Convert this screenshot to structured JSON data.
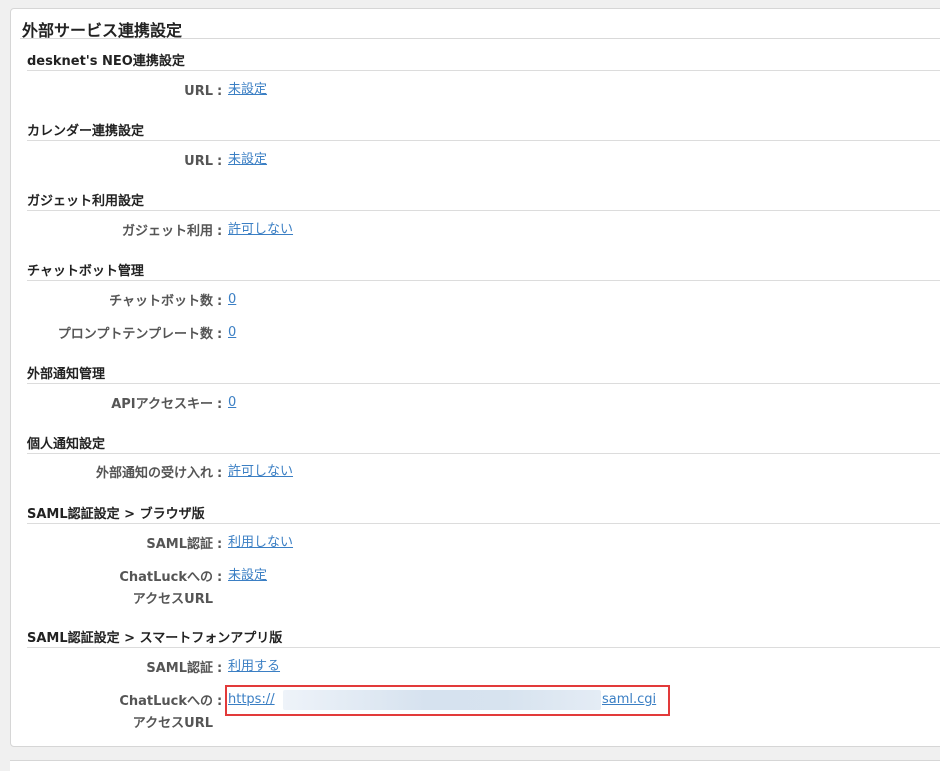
{
  "page": {
    "title": "外部サービス連携設定"
  },
  "sections": {
    "neo": {
      "heading": "desknet's NEO連携設定",
      "url_label": "URL",
      "url_value": "未設定"
    },
    "calendar": {
      "heading": "カレンダー連携設定",
      "url_label": "URL",
      "url_value": "未設定"
    },
    "gadget": {
      "heading": "ガジェット利用設定",
      "use_label": "ガジェット利用",
      "use_value": "許可しない"
    },
    "chatbot": {
      "heading": "チャットボット管理",
      "count_label": "チャットボット数",
      "count_value": "0",
      "template_label": "プロンプトテンプレート数",
      "template_value": "0"
    },
    "external_notify": {
      "heading": "外部通知管理",
      "apikey_label": "APIアクセスキー",
      "apikey_value": "0"
    },
    "personal_notify": {
      "heading": "個人通知設定",
      "accept_label": "外部通知の受け入れ",
      "accept_value": "許可しない"
    },
    "saml_browser": {
      "heading": "SAML認証設定 > ブラウザ版",
      "auth_label": "SAML認証",
      "auth_value": "利用しない",
      "url_label_line1": "ChatLuckへの",
      "url_label_line2": "アクセスURL",
      "url_value": "未設定"
    },
    "saml_smartphone": {
      "heading": "SAML認証設定 > スマートフォンアプリ版",
      "auth_label": "SAML認証",
      "auth_value": "利用する",
      "url_label_line1": "ChatLuckへの",
      "url_label_line2": "アクセスURL",
      "url_prefix": "https://",
      "url_suffix": "saml.cgi"
    }
  },
  "separator": ":",
  "colors": {
    "link": "#3b7fc4",
    "highlight_box": "#e23a3a",
    "label": "#555555",
    "heading": "#222222"
  }
}
